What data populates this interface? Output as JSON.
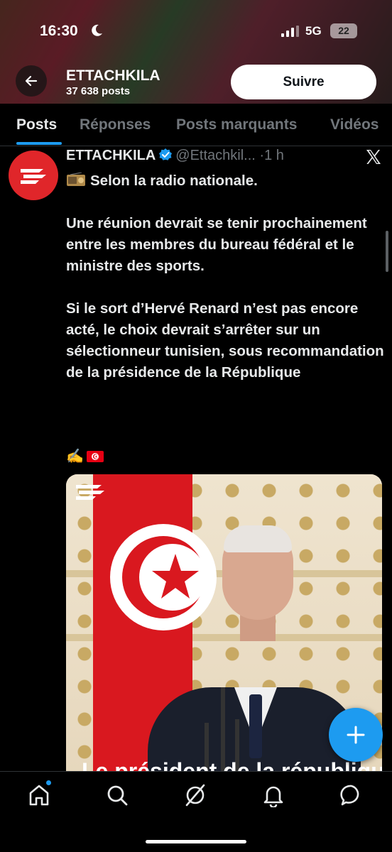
{
  "status_bar": {
    "time": "16:30",
    "network": "5G",
    "battery": "22"
  },
  "header": {
    "name": "ETTACHKILA",
    "post_count": "37 638 posts",
    "follow_label": "Suivre"
  },
  "tabs": [
    {
      "label": "Posts",
      "active": true
    },
    {
      "label": "Réponses",
      "active": false
    },
    {
      "label": "Posts marquants",
      "active": false
    },
    {
      "label": "Vidéos",
      "active": false
    }
  ],
  "post": {
    "author": "ETTACHKILA",
    "handle": "@Ettachkil...",
    "dot": "·",
    "time": "1 h",
    "lines": [
      "Selon la radio nationale.",
      "Une réunion devrait se tenir prochainement entre les membres du bureau fédéral et le ministre des sports.",
      "Si le sort d’Hervé Renard n’est pas encore acté, le choix devrait s’arrêter sur un sélectionneur tunisien, sous recommandation de la présidence de la République"
    ],
    "emojis": "✍️🇹🇳",
    "media_caption": "Le président de la république"
  },
  "icons": {
    "back": "arrow-left-icon",
    "verified": "verified-badge-icon",
    "x": "x-logo-icon",
    "fab": "plus-icon",
    "home": "home-icon",
    "search": "search-icon",
    "grok": "grok-icon",
    "notifications": "bell-icon",
    "messages": "messages-icon"
  },
  "colors": {
    "accent": "#1d9bf0",
    "brand_red": "#e0262a",
    "background": "#000000",
    "muted": "#71767b"
  }
}
